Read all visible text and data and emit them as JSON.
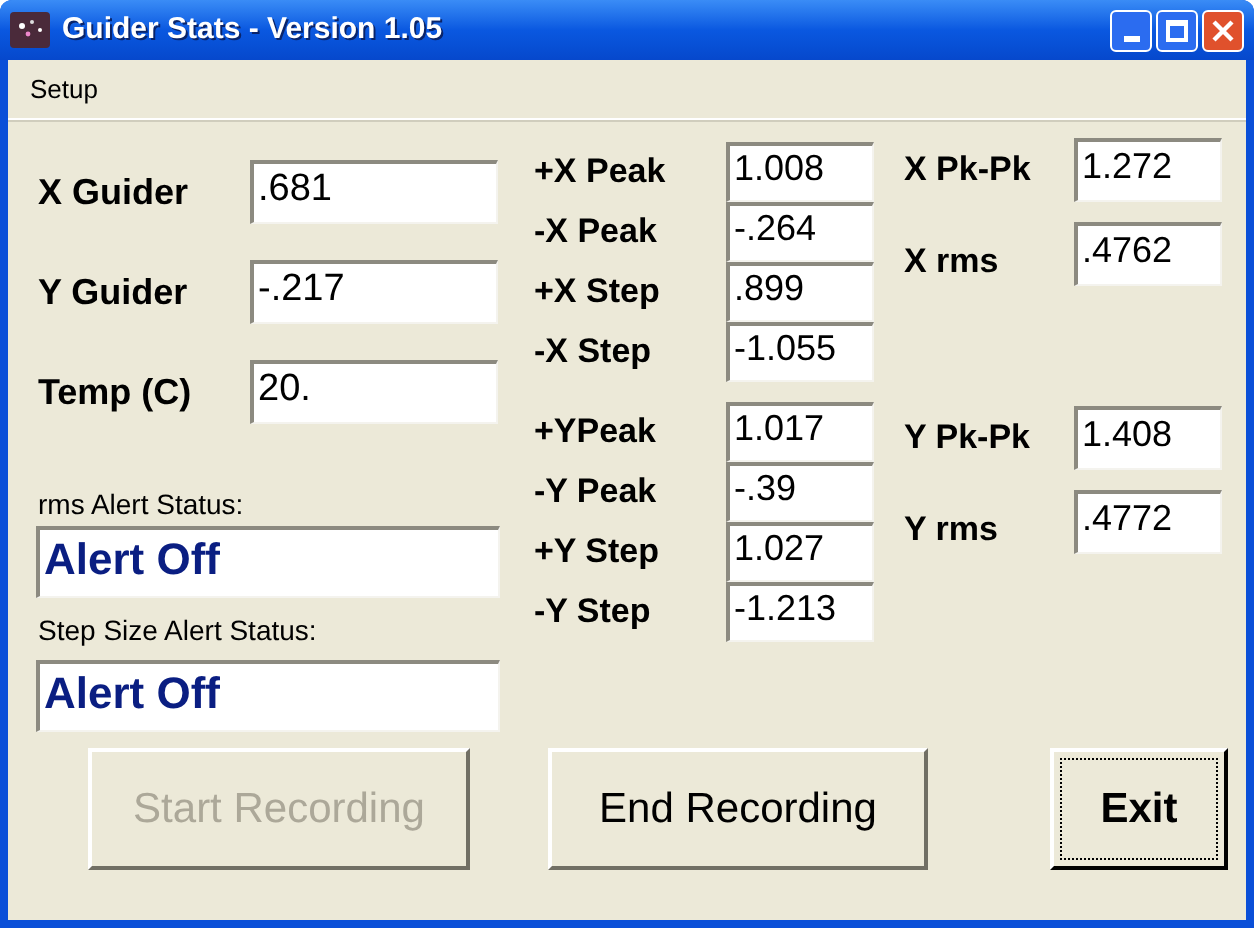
{
  "window": {
    "title": "Guider Stats - Version 1.05"
  },
  "menu": [
    "Setup"
  ],
  "guider_fields": [
    {
      "label": "X Guider",
      "value": ".681"
    },
    {
      "label": "Y Guider",
      "value": "-.217"
    },
    {
      "label": "Temp (C)",
      "value": "20."
    }
  ],
  "alerts": [
    {
      "label": "rms Alert Status:",
      "value": "Alert Off"
    },
    {
      "label": "Step Size Alert Status:",
      "value": "Alert Off"
    }
  ],
  "peak_groups": [
    [
      {
        "label": "+X Peak",
        "value": "1.008"
      },
      {
        "label": "-X Peak",
        "value": "-.264"
      },
      {
        "label": "+X Step",
        "value": ".899"
      },
      {
        "label": "-X Step",
        "value": "-1.055"
      }
    ],
    [
      {
        "label": "+YPeak",
        "value": "1.017"
      },
      {
        "label": "-Y Peak",
        "value": "-.39"
      },
      {
        "label": "+Y Step",
        "value": "1.027"
      },
      {
        "label": "-Y Step",
        "value": "-1.213"
      }
    ]
  ],
  "stat_groups": [
    [
      {
        "label": "X Pk-Pk",
        "value": "1.272"
      },
      {
        "label": "X rms",
        "value": ".4762"
      }
    ],
    [
      {
        "label": "Y Pk-Pk",
        "value": "1.408"
      },
      {
        "label": "Y rms",
        "value": ".4772"
      }
    ]
  ],
  "buttons": [
    {
      "label": "Start Recording",
      "disabled": true,
      "default": false
    },
    {
      "label": "End Recording",
      "disabled": false,
      "default": false
    },
    {
      "label": "Exit",
      "disabled": false,
      "default": true
    }
  ]
}
